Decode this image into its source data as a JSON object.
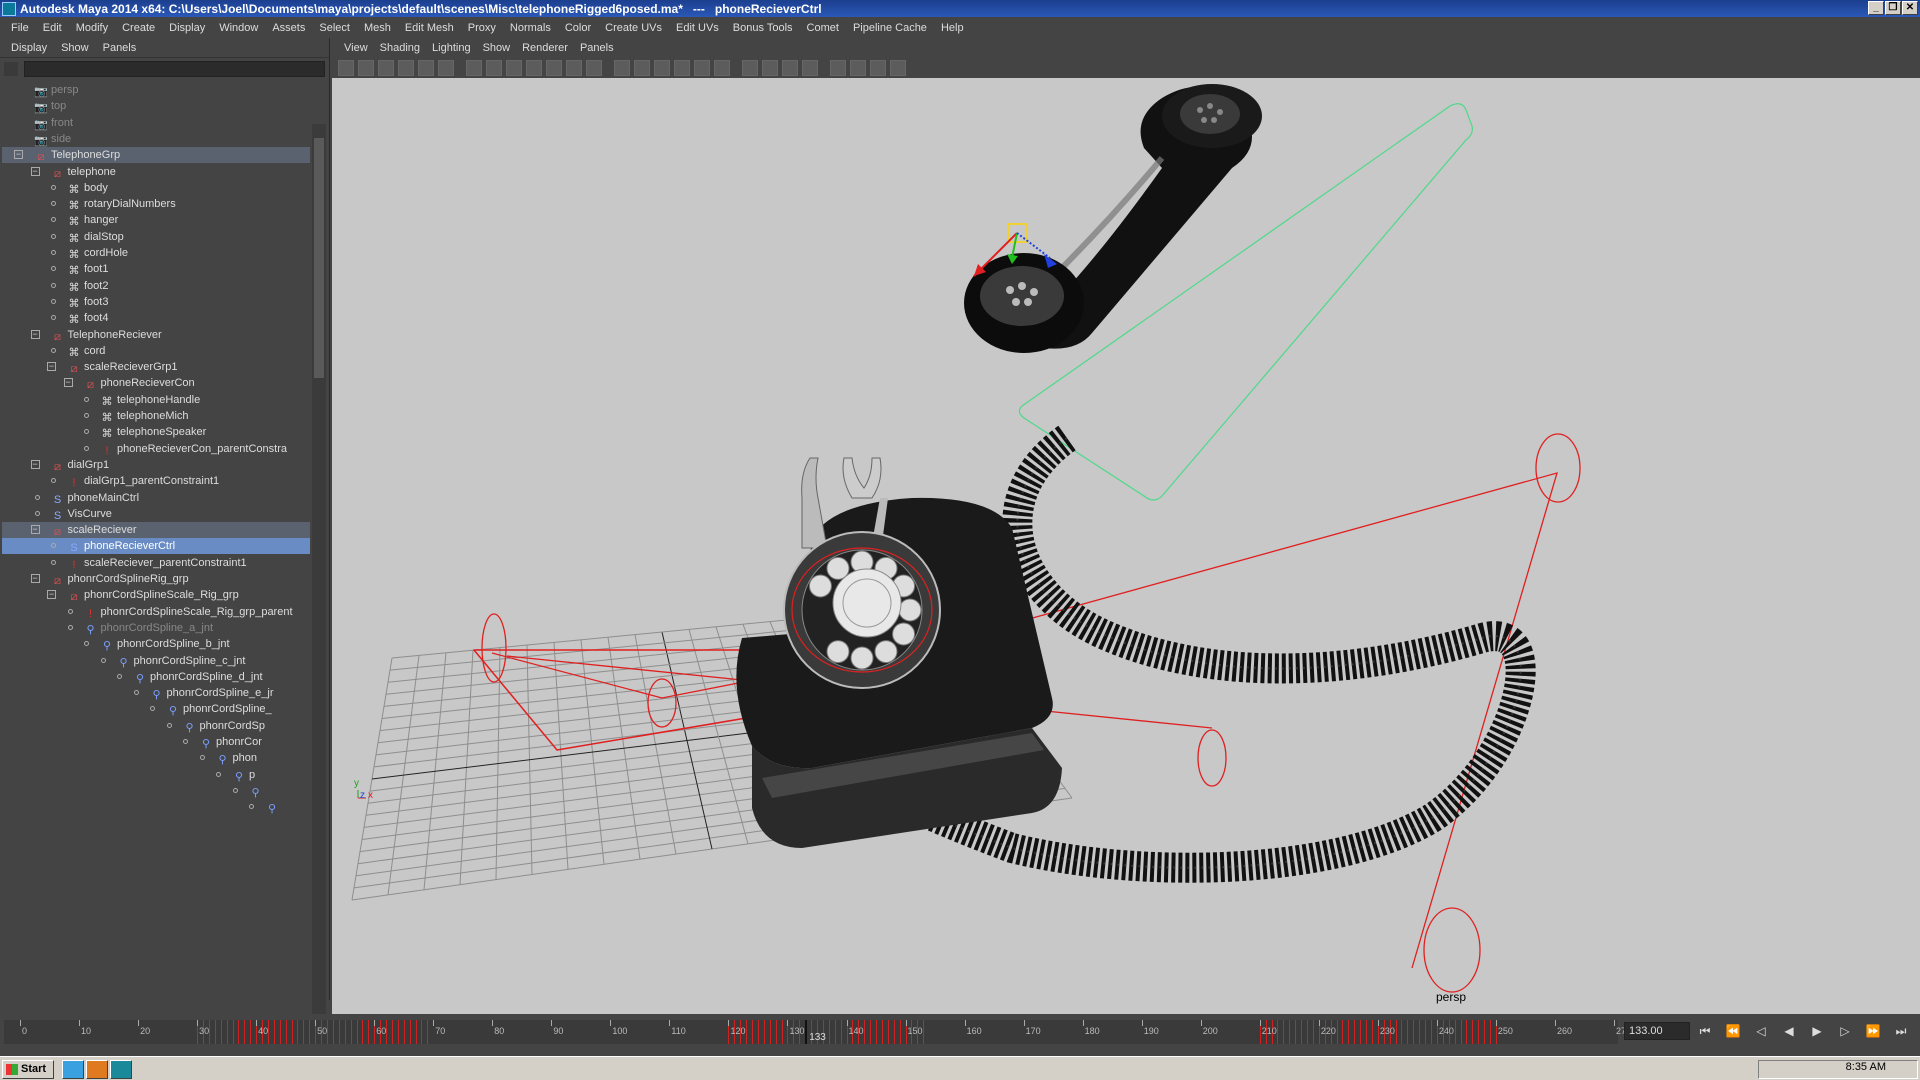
{
  "window": {
    "title": "Autodesk Maya 2014 x64: C:\\Users\\Joel\\Documents\\maya\\projects\\default\\scenes\\Misc\\telephoneRigged6posed.ma*   ---   phoneRecieverCtrl"
  },
  "menubar": [
    "File",
    "Edit",
    "Modify",
    "Create",
    "Display",
    "Window",
    "Assets",
    "Select",
    "Mesh",
    "Edit Mesh",
    "Proxy",
    "Normals",
    "Color",
    "Create UVs",
    "Edit UVs",
    "Bonus Tools",
    "Comet",
    "Pipeline Cache",
    "Help"
  ],
  "outliner": {
    "menu": [
      "Display",
      "Show",
      "Panels"
    ],
    "rows": [
      {
        "label": "persp",
        "indent": 0,
        "type": "camera",
        "dim": true
      },
      {
        "label": "top",
        "indent": 0,
        "type": "camera",
        "dim": true
      },
      {
        "label": "front",
        "indent": 0,
        "type": "camera",
        "dim": true
      },
      {
        "label": "side",
        "indent": 0,
        "type": "camera",
        "dim": true
      },
      {
        "label": "TelephoneGrp",
        "indent": 0,
        "type": "group",
        "state": "sel-parent"
      },
      {
        "label": "telephone",
        "indent": 1,
        "type": "group"
      },
      {
        "label": "body",
        "indent": 2,
        "type": "mesh"
      },
      {
        "label": "rotaryDialNumbers",
        "indent": 2,
        "type": "mesh"
      },
      {
        "label": "hanger",
        "indent": 2,
        "type": "mesh"
      },
      {
        "label": "dialStop",
        "indent": 2,
        "type": "mesh"
      },
      {
        "label": "cordHole",
        "indent": 2,
        "type": "mesh"
      },
      {
        "label": "foot1",
        "indent": 2,
        "type": "mesh"
      },
      {
        "label": "foot2",
        "indent": 2,
        "type": "mesh"
      },
      {
        "label": "foot3",
        "indent": 2,
        "type": "mesh"
      },
      {
        "label": "foot4",
        "indent": 2,
        "type": "mesh"
      },
      {
        "label": "TelephoneReciever",
        "indent": 1,
        "type": "group"
      },
      {
        "label": "cord",
        "indent": 2,
        "type": "mesh"
      },
      {
        "label": "scaleRecieverGrp1",
        "indent": 2,
        "type": "group"
      },
      {
        "label": "phoneRecieverCon",
        "indent": 3,
        "type": "group"
      },
      {
        "label": "telephoneHandle",
        "indent": 4,
        "type": "mesh"
      },
      {
        "label": "telephoneMich",
        "indent": 4,
        "type": "mesh"
      },
      {
        "label": "telephoneSpeaker",
        "indent": 4,
        "type": "mesh"
      },
      {
        "label": "phoneRecieverCon_parentConstra",
        "indent": 4,
        "type": "constraint"
      },
      {
        "label": "dialGrp1",
        "indent": 1,
        "type": "group"
      },
      {
        "label": "dialGrp1_parentConstraint1",
        "indent": 2,
        "type": "constraint"
      },
      {
        "label": "phoneMainCtrl",
        "indent": 1,
        "type": "curve"
      },
      {
        "label": "VisCurve",
        "indent": 1,
        "type": "curve"
      },
      {
        "label": "scaleReciever",
        "indent": 1,
        "type": "group",
        "state": "sel-parent"
      },
      {
        "label": "phoneRecieverCtrl",
        "indent": 2,
        "type": "curve",
        "state": "selected"
      },
      {
        "label": "scaleReciever_parentConstraint1",
        "indent": 2,
        "type": "constraint"
      },
      {
        "label": "phonrCordSplineRig_grp",
        "indent": 1,
        "type": "group"
      },
      {
        "label": "phonrCordSplineScale_Rig_grp",
        "indent": 2,
        "type": "group"
      },
      {
        "label": "phonrCordSplineScale_Rig_grp_parent",
        "indent": 3,
        "type": "constraint"
      },
      {
        "label": "phonrCordSpline_a_jnt",
        "indent": 3,
        "type": "joint",
        "dim": true
      },
      {
        "label": "phonrCordSpline_b_jnt",
        "indent": 4,
        "type": "joint"
      },
      {
        "label": "phonrCordSpline_c_jnt",
        "indent": 5,
        "type": "joint"
      },
      {
        "label": "phonrCordSpline_d_jnt",
        "indent": 6,
        "type": "joint"
      },
      {
        "label": "phonrCordSpline_e_jr",
        "indent": 7,
        "type": "joint"
      },
      {
        "label": "phonrCordSpline_",
        "indent": 8,
        "type": "joint"
      },
      {
        "label": "phonrCordSp",
        "indent": 9,
        "type": "joint"
      },
      {
        "label": "phonrCor",
        "indent": 10,
        "type": "joint"
      },
      {
        "label": "phon",
        "indent": 11,
        "type": "joint"
      },
      {
        "label": "p",
        "indent": 12,
        "type": "joint"
      },
      {
        "label": "",
        "indent": 13,
        "type": "joint"
      },
      {
        "label": "",
        "indent": 14,
        "type": "joint"
      }
    ]
  },
  "viewport": {
    "menu": [
      "View",
      "Shading",
      "Lighting",
      "Show",
      "Renderer",
      "Panels"
    ],
    "camera": "persp",
    "axis_y": "y",
    "axis_x": "x",
    "axis_z": "z"
  },
  "timeline": {
    "start": 0,
    "end": 270,
    "labels": [
      "0",
      "10",
      "20",
      "30",
      "40",
      "50",
      "60",
      "70",
      "80",
      "90",
      "100",
      "110",
      "120",
      "130",
      "140",
      "150",
      "160",
      "170",
      "180",
      "190",
      "200",
      "210",
      "220",
      "230",
      "240",
      "250",
      "260",
      "27"
    ],
    "current_frame": 133,
    "current_label": "133",
    "frame_field": "133.00",
    "keys": [
      30,
      31,
      32,
      33,
      34,
      35,
      36,
      37,
      38,
      39,
      40,
      41,
      42,
      43,
      44,
      45,
      46,
      47,
      48,
      49,
      50,
      51,
      52,
      53,
      54,
      55,
      56,
      57,
      58,
      59,
      60,
      61,
      62,
      63,
      64,
      65,
      66,
      67,
      68,
      69,
      120,
      121,
      122,
      123,
      124,
      125,
      126,
      127,
      128,
      129,
      130,
      131,
      132,
      133,
      134,
      135,
      136,
      137,
      138,
      139,
      140,
      141,
      142,
      143,
      144,
      145,
      146,
      147,
      148,
      149,
      150,
      151,
      152,
      153,
      210,
      211,
      212,
      213,
      214,
      215,
      216,
      217,
      218,
      219,
      220,
      221,
      222,
      223,
      224,
      225,
      226,
      227,
      228,
      229,
      230,
      231,
      232,
      233,
      234,
      235,
      236,
      237,
      238,
      239,
      240,
      241,
      242,
      243,
      244,
      245,
      246,
      247,
      248,
      249,
      250
    ]
  },
  "taskbar": {
    "start": "Start",
    "clock": "8:35 AM"
  },
  "colors": {
    "title_bg": "#1c3f8f",
    "ui_bg": "#444444",
    "viewport_bg": "#c8c8c8",
    "selection": "#6a8cc4",
    "control_red": "#e02020",
    "bbox_green": "#4ed98a",
    "keyframe": "#d02020"
  }
}
